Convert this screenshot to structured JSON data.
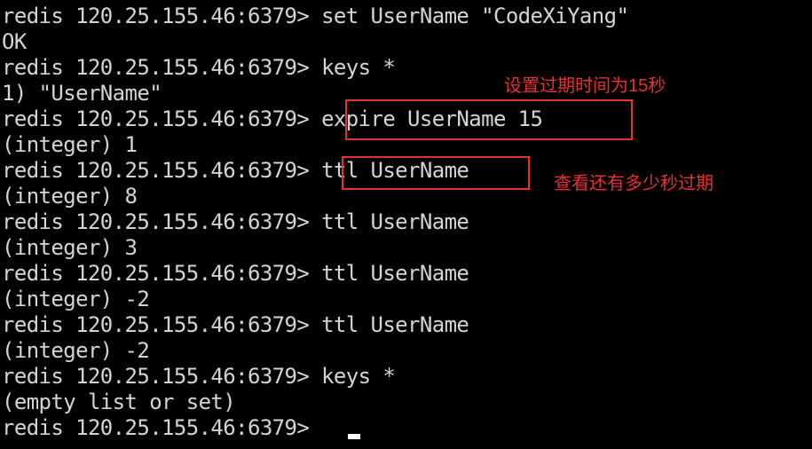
{
  "terminal": {
    "prompt": "redis 120.25.155.46:6379>",
    "lines": [
      "redis 120.25.155.46:6379> set UserName \"CodeXiYang\"",
      "OK",
      "redis 120.25.155.46:6379> keys *",
      "1) \"UserName\"",
      "redis 120.25.155.46:6379> expire UserName 15",
      "(integer) 1",
      "redis 120.25.155.46:6379> ttl UserName",
      "(integer) 8",
      "redis 120.25.155.46:6379> ttl UserName",
      "(integer) 3",
      "redis 120.25.155.46:6379> ttl UserName",
      "(integer) -2",
      "redis 120.25.155.46:6379> ttl UserName",
      "(integer) -2",
      "redis 120.25.155.46:6379> keys *",
      "(empty list or set)",
      "redis 120.25.155.46:6379> "
    ]
  },
  "annotations": {
    "expire_note": "设置过期时间为15秒",
    "ttl_note": "查看还有多少秒过期"
  },
  "colors": {
    "background": "#000000",
    "text": "#d4d4d4",
    "annotation": "#e8312f",
    "cursor": "#ffffff"
  }
}
